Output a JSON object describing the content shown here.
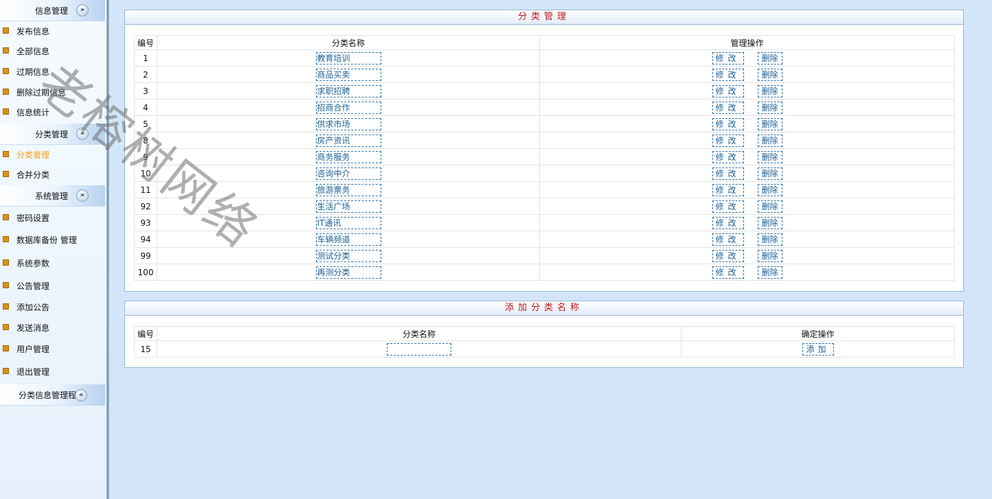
{
  "sidebar": {
    "sections": [
      {
        "title": "信息管理",
        "toggle": "collapse-icon",
        "items": [
          "发布信息",
          "全部信息",
          "过期信息",
          "删除过期信息",
          "信息统计"
        ]
      },
      {
        "title": "分类管理",
        "toggle": "collapse-icon",
        "items": [
          "分类管理",
          "合并分类"
        ],
        "active_item": "分类管理"
      },
      {
        "title": "系统管理",
        "toggle": "collapse-icon",
        "items": [
          "密码设置",
          "数据库备份 管理",
          "系统参数",
          "公告管理",
          "添加公告",
          "发送消息",
          "用户管理",
          "退出管理"
        ]
      },
      {
        "title": "分类信息管理程序",
        "toggle": "collapse-icon"
      }
    ]
  },
  "watermark": "老榕树网络",
  "category_panel": {
    "title": "分类管理",
    "columns": [
      "编号",
      "分类名称",
      "管理操作"
    ],
    "edit_label": "修改",
    "delete_label": "删除",
    "rows": [
      {
        "id": "1",
        "name": "教育培训"
      },
      {
        "id": "2",
        "name": "商品买卖"
      },
      {
        "id": "3",
        "name": "求职招聘"
      },
      {
        "id": "4",
        "name": "招商合作"
      },
      {
        "id": "5",
        "name": "供求市场"
      },
      {
        "id": "8",
        "name": "房产资讯"
      },
      {
        "id": "9",
        "name": "商务服务"
      },
      {
        "id": "10",
        "name": "咨询中介"
      },
      {
        "id": "11",
        "name": "旅游票务"
      },
      {
        "id": "92",
        "name": "生活广场"
      },
      {
        "id": "93",
        "name": "IT通讯"
      },
      {
        "id": "94",
        "name": "车辆频道"
      },
      {
        "id": "99",
        "name": "测试分类"
      },
      {
        "id": "100",
        "name": "再测分类"
      }
    ]
  },
  "add_panel": {
    "title": "添加分类名称",
    "columns": [
      "编号",
      "分类名称",
      "确定操作"
    ],
    "row": {
      "id": "15",
      "name_value": ""
    },
    "add_label": "添加"
  },
  "colors": {
    "accent_red": "#c0141c",
    "link_blue": "#1b5f95",
    "active_menu": "#f0a020",
    "page_bg": "#d3e6f9"
  }
}
